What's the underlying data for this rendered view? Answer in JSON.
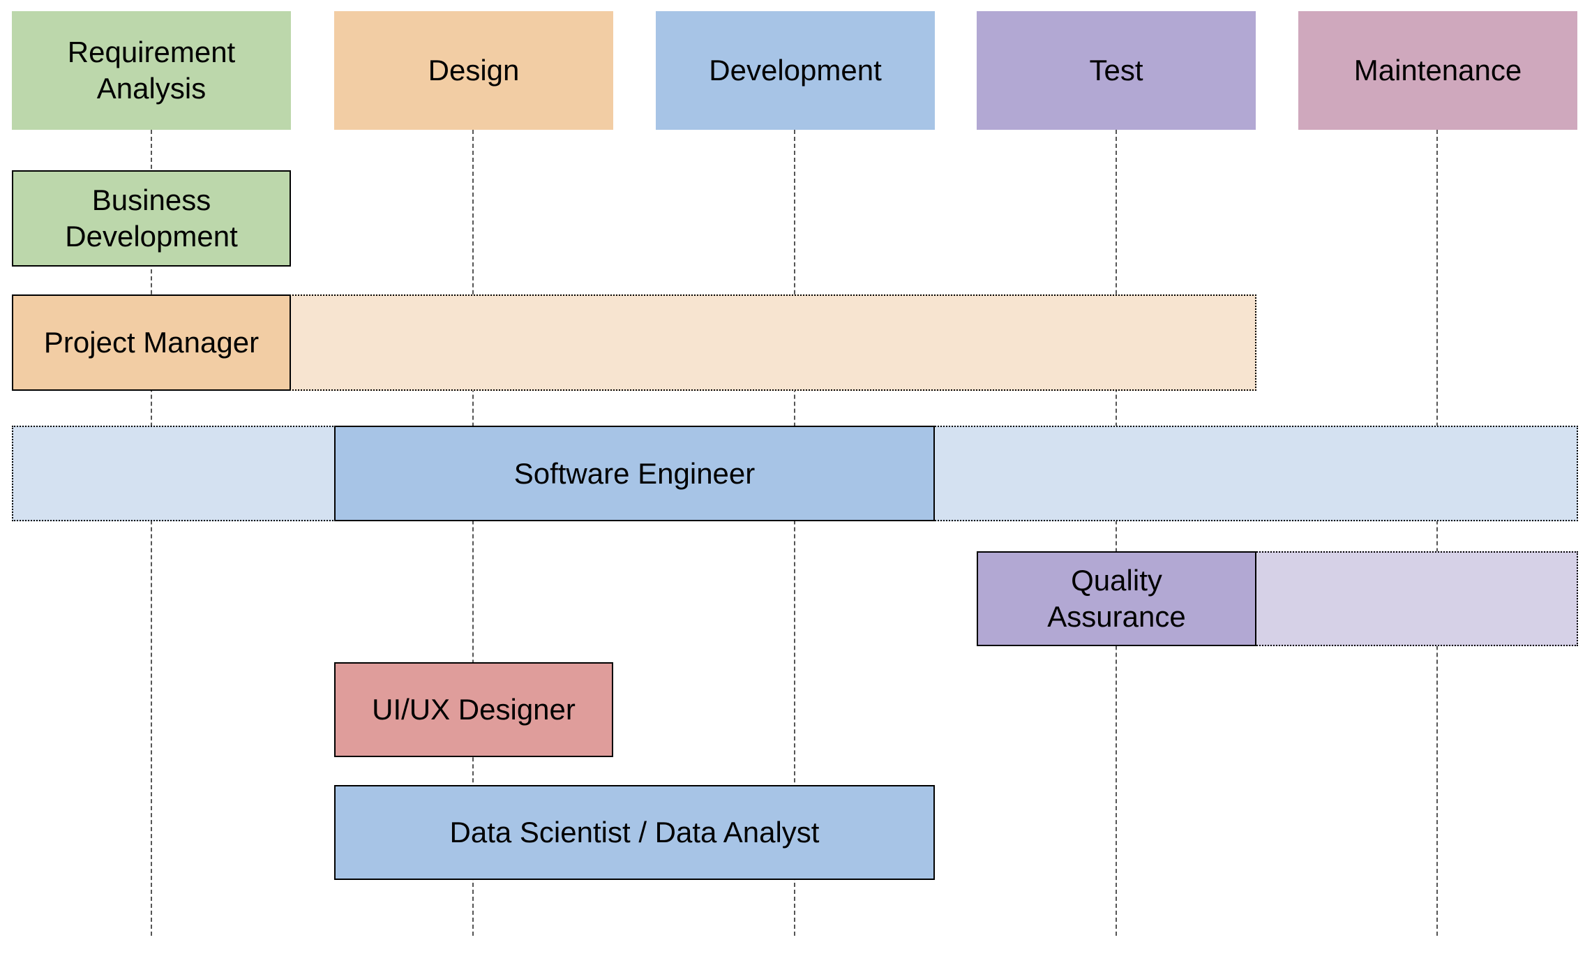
{
  "phases": [
    {
      "label": "Requirement\nAnalysis",
      "color": "#bcd7ab"
    },
    {
      "label": "Design",
      "color": "#f2cda4"
    },
    {
      "label": "Development",
      "color": "#a7c4e6"
    },
    {
      "label": "Test",
      "color": "#b2a8d3"
    },
    {
      "label": "Maintenance",
      "color": "#cfa8bd"
    }
  ],
  "roles": [
    {
      "label": "Business\nDevelopment",
      "color": "#bcd7ab",
      "solid_phases": [
        "Requirement Analysis"
      ],
      "extended_phases": []
    },
    {
      "label": "Project Manager",
      "color": "#f2cda4",
      "extension_color": "#f7e4d0",
      "solid_phases": [
        "Requirement Analysis"
      ],
      "extended_phases": [
        "Design",
        "Development",
        "Test"
      ]
    },
    {
      "label": "Software Engineer",
      "color": "#a7c4e6",
      "extension_color": "#d4e1f1",
      "solid_phases": [
        "Design",
        "Development"
      ],
      "extended_phases": [
        "Requirement Analysis",
        "Test",
        "Maintenance"
      ]
    },
    {
      "label": "Quality\nAssurance",
      "color": "#b2a8d3",
      "extension_color": "#d6d1e7",
      "solid_phases": [
        "Test"
      ],
      "extended_phases": [
        "Maintenance"
      ]
    },
    {
      "label": "UI/UX Designer",
      "color": "#df9d9b",
      "solid_phases": [
        "Design"
      ],
      "extended_phases": []
    },
    {
      "label": "Data Scientist / Data Analyst",
      "color": "#a7c4e6",
      "solid_phases": [
        "Design",
        "Development"
      ],
      "extended_phases": []
    }
  ]
}
